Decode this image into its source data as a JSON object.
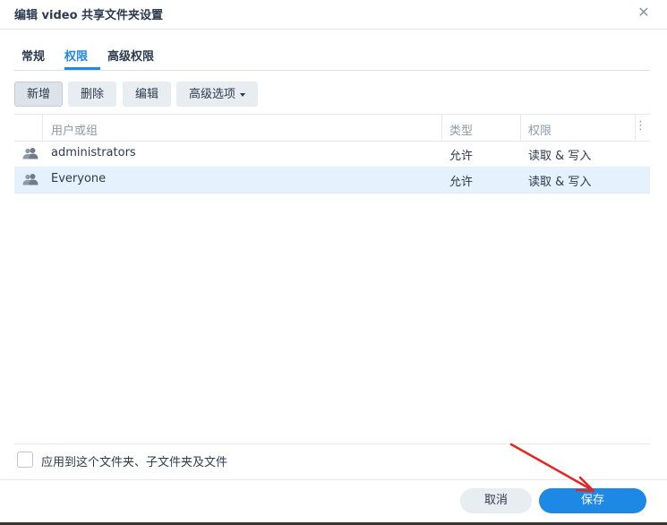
{
  "dialog": {
    "title": "编辑 video 共享文件夹设置",
    "close_symbol": "✕"
  },
  "tabs": [
    {
      "label": "常规",
      "active": false
    },
    {
      "label": "权限",
      "active": true
    },
    {
      "label": "高级权限",
      "active": false
    }
  ],
  "toolbar": {
    "add_label": "新增",
    "delete_label": "删除",
    "edit_label": "编辑",
    "advanced_label": "高级选项"
  },
  "grid": {
    "columns": {
      "user_or_group": "用户或组",
      "type": "类型",
      "permission": "权限"
    },
    "rows": [
      {
        "name": "administrators",
        "type": "允许",
        "permission": "读取 & 写入",
        "icon": "user-group-icon",
        "selected": false
      },
      {
        "name": "Everyone",
        "type": "允许",
        "permission": "读取 & 写入",
        "icon": "user-group-icon",
        "selected": true
      }
    ]
  },
  "apply_option": {
    "label": "应用到这个文件夹、子文件夹及文件",
    "checked": false
  },
  "footer": {
    "cancel_label": "取消",
    "save_label": "保存"
  },
  "colors": {
    "accent": "#1e88e5",
    "selected_row": "#e5f1fc",
    "annotation_arrow": "#e8241f"
  }
}
